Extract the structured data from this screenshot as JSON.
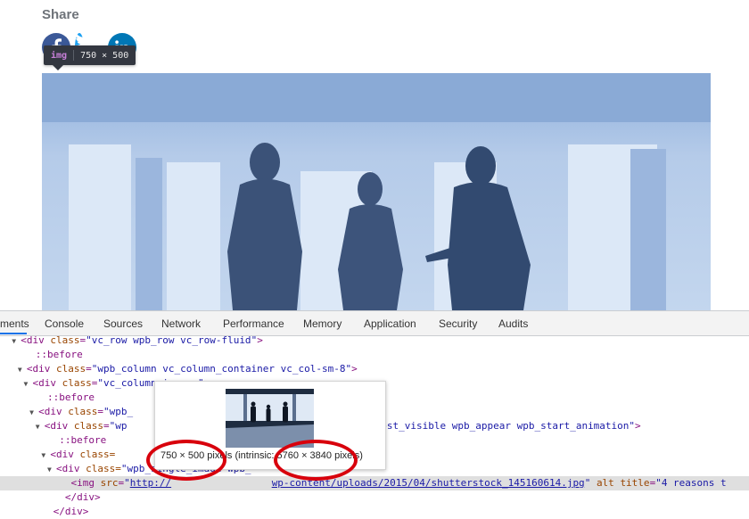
{
  "page": {
    "share_label": "Share",
    "social": [
      {
        "name": "facebook",
        "icon": "facebook-icon",
        "color": "#3b5998"
      },
      {
        "name": "twitter",
        "icon": "twitter-icon",
        "color": "#1da1f2"
      },
      {
        "name": "linkedin",
        "icon": "linkedin-icon",
        "color": "#0077b5"
      }
    ],
    "tooltip": {
      "tag": "img",
      "size": "750 × 500"
    }
  },
  "devtools": {
    "tabs": [
      "ments",
      "Console",
      "Sources",
      "Network",
      "Performance",
      "Memory",
      "Application",
      "Security",
      "Audits"
    ],
    "lines": {
      "l1_class": "vc_row wpb_row vc_row-fluid",
      "l2": "::before",
      "l3_class": "wpb_column vc_column_container vc_col-sm-8",
      "l4_class": "vc_column-inner ",
      "l5": "::before",
      "l6_class": "wpb_",
      "l7_class": "wp",
      "l7_tail": "animate_when_almost_visible wpb_appear wpb_start_animation",
      "l8": "::before",
      "l9_class": "",
      "l10_class": "wpb_single_image wpb_",
      "l11_src_a": "http://",
      "l11_src_b": "wp-content/uploads/2015/04/shutterstock_145160614.jpg",
      "l11_tail": "4 reasons t",
      "l12": "</div>",
      "l13": "</div>"
    },
    "preview": {
      "rendered": "750 × 500",
      "rendered_suffix": " pixels (intrinsic: ",
      "intrinsic": "5760 × 3840",
      "intrinsic_suffix": " pixels)"
    },
    "highlight_color": "#d8000c"
  }
}
